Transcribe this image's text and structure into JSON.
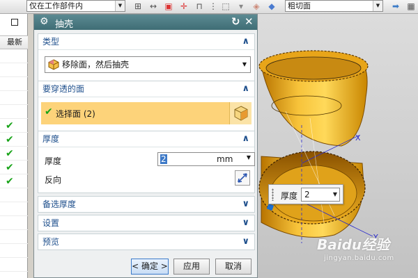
{
  "toolbar": {
    "filter_value": "仅在工作部件内",
    "view_value": "粗切面"
  },
  "part_list": {
    "column_header": "最新",
    "checked_rows": 5
  },
  "dialog": {
    "title": "抽壳",
    "type_group": {
      "heading": "类型",
      "selected": "移除面，然后抽壳"
    },
    "faces_group": {
      "heading": "要穿透的面",
      "select_label": "选择面 (2)"
    },
    "thickness_group": {
      "heading": "厚度",
      "thickness_label": "厚度",
      "thickness_value": "2",
      "thickness_unit": "mm",
      "reverse_label": "反向"
    },
    "collapsed_groups": [
      {
        "label": "备选厚度"
      },
      {
        "label": "设置"
      },
      {
        "label": "预览"
      }
    ],
    "buttons": {
      "ok": "< 确定 >",
      "apply": "应用",
      "cancel": "取消"
    }
  },
  "viewport_overlay": {
    "thickness_label": "厚度",
    "thickness_value": "2",
    "axis_x": "X",
    "axis_y": "Y"
  },
  "watermark": {
    "brand": "Baidu经验",
    "site": "jingyan.baidu.com"
  },
  "colors": {
    "title_bar": "#4a7b83",
    "selected_row": "#fdd37a",
    "part_fill": "#f2b21a",
    "section_heading": "#1e4f8c"
  }
}
